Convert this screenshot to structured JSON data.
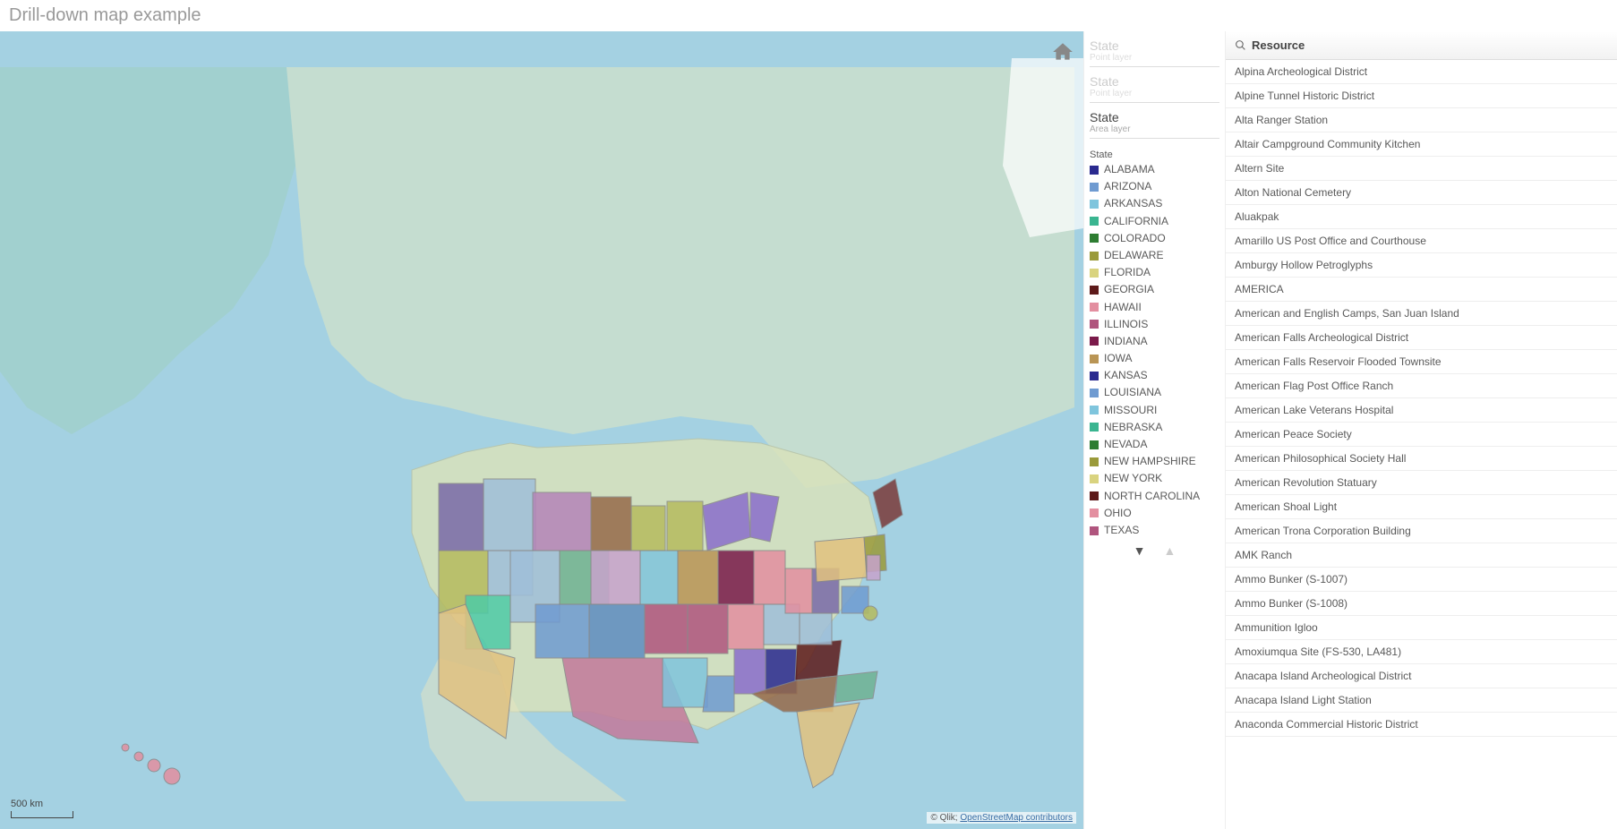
{
  "title": "Drill-down map example",
  "scale": "500 km",
  "attribution_prefix": "© Qlik; ",
  "attribution_link": "OpenStreetMap contributors",
  "legend": {
    "inactive": [
      {
        "title": "State",
        "sub": "Point layer"
      },
      {
        "title": "State",
        "sub": "Point layer"
      }
    ],
    "active": {
      "title": "State",
      "sub": "Area layer",
      "dimension": "State"
    },
    "items": [
      {
        "label": "ALABAMA",
        "color": "#2a2a8f"
      },
      {
        "label": "ARIZONA",
        "color": "#6f9bd1"
      },
      {
        "label": "ARKANSAS",
        "color": "#7fc5dd"
      },
      {
        "label": "CALIFORNIA",
        "color": "#3ab590"
      },
      {
        "label": "COLORADO",
        "color": "#2e7d32"
      },
      {
        "label": "DELAWARE",
        "color": "#9a9a3a"
      },
      {
        "label": "FLORIDA",
        "color": "#d9d37f"
      },
      {
        "label": "GEORGIA",
        "color": "#5d1a1a"
      },
      {
        "label": "HAWAII",
        "color": "#e38fa0"
      },
      {
        "label": "ILLINOIS",
        "color": "#b0557e"
      },
      {
        "label": "INDIANA",
        "color": "#7a1a4a"
      },
      {
        "label": "IOWA",
        "color": "#b99555"
      },
      {
        "label": "KANSAS",
        "color": "#2a2a8f"
      },
      {
        "label": "LOUISIANA",
        "color": "#6f9bd1"
      },
      {
        "label": "MISSOURI",
        "color": "#7fc5dd"
      },
      {
        "label": "NEBRASKA",
        "color": "#3ab590"
      },
      {
        "label": "NEVADA",
        "color": "#2e7d32"
      },
      {
        "label": "NEW HAMPSHIRE",
        "color": "#9a9a3a"
      },
      {
        "label": "NEW YORK",
        "color": "#d9d37f"
      },
      {
        "label": "NORTH CAROLINA",
        "color": "#5d1a1a"
      },
      {
        "label": "OHIO",
        "color": "#e38fa0"
      },
      {
        "label": "TEXAS",
        "color": "#b0557e"
      }
    ]
  },
  "resource_header": "Resource",
  "resources": [
    "Alpina Archeological District",
    "Alpine Tunnel Historic District",
    "Alta Ranger Station",
    "Altair Campground Community Kitchen",
    "Altern Site",
    "Alton National Cemetery",
    "Aluakpak",
    "Amarillo US Post Office and Courthouse",
    "Amburgy Hollow Petroglyphs",
    "AMERICA",
    "American and English Camps, San Juan Island",
    "American Falls Archeological District",
    "American Falls Reservoir Flooded Townsite",
    "American Flag Post Office Ranch",
    "American Lake Veterans Hospital",
    "American Peace Society",
    "American Philosophical Society Hall",
    "American Revolution Statuary",
    "American Shoal Light",
    "American Trona Corporation Building",
    "AMK Ranch",
    "Ammo Bunker (S-1007)",
    "Ammo Bunker (S-1008)",
    "Ammunition Igloo",
    "Amoxiumqua Site (FS-530, LA481)",
    "Anacapa Island Archeological District",
    "Anacapa Island Light Station",
    "Anaconda Commercial Historic District"
  ],
  "chart_data": {
    "type": "map",
    "region": "North America (US states colored)",
    "note": "Choropleth of US states by categorical color; exact geometries approximated",
    "states_shown": [
      "ALABAMA",
      "ARIZONA",
      "ARKANSAS",
      "CALIFORNIA",
      "COLORADO",
      "DELAWARE",
      "FLORIDA",
      "GEORGIA",
      "HAWAII",
      "ILLINOIS",
      "INDIANA",
      "IOWA",
      "KANSAS",
      "LOUISIANA",
      "MISSOURI",
      "NEBRASKA",
      "NEVADA",
      "NEW HAMPSHIRE",
      "NEW YORK",
      "NORTH CAROLINA",
      "OHIO",
      "TEXAS"
    ]
  }
}
